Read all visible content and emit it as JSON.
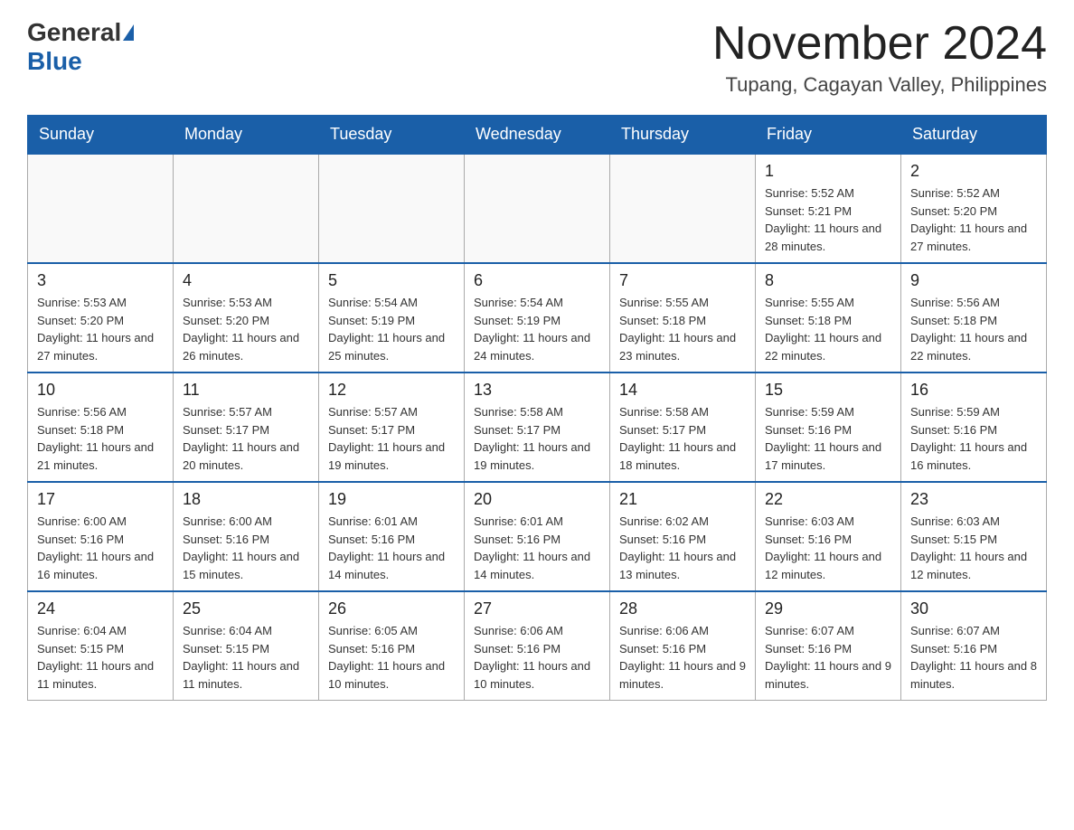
{
  "header": {
    "logo_general": "General",
    "logo_blue": "Blue",
    "month_title": "November 2024",
    "location": "Tupang, Cagayan Valley, Philippines"
  },
  "calendar": {
    "days_of_week": [
      "Sunday",
      "Monday",
      "Tuesday",
      "Wednesday",
      "Thursday",
      "Friday",
      "Saturday"
    ],
    "weeks": [
      [
        {
          "day": "",
          "info": ""
        },
        {
          "day": "",
          "info": ""
        },
        {
          "day": "",
          "info": ""
        },
        {
          "day": "",
          "info": ""
        },
        {
          "day": "",
          "info": ""
        },
        {
          "day": "1",
          "info": "Sunrise: 5:52 AM\nSunset: 5:21 PM\nDaylight: 11 hours and 28 minutes."
        },
        {
          "day": "2",
          "info": "Sunrise: 5:52 AM\nSunset: 5:20 PM\nDaylight: 11 hours and 27 minutes."
        }
      ],
      [
        {
          "day": "3",
          "info": "Sunrise: 5:53 AM\nSunset: 5:20 PM\nDaylight: 11 hours and 27 minutes."
        },
        {
          "day": "4",
          "info": "Sunrise: 5:53 AM\nSunset: 5:20 PM\nDaylight: 11 hours and 26 minutes."
        },
        {
          "day": "5",
          "info": "Sunrise: 5:54 AM\nSunset: 5:19 PM\nDaylight: 11 hours and 25 minutes."
        },
        {
          "day": "6",
          "info": "Sunrise: 5:54 AM\nSunset: 5:19 PM\nDaylight: 11 hours and 24 minutes."
        },
        {
          "day": "7",
          "info": "Sunrise: 5:55 AM\nSunset: 5:18 PM\nDaylight: 11 hours and 23 minutes."
        },
        {
          "day": "8",
          "info": "Sunrise: 5:55 AM\nSunset: 5:18 PM\nDaylight: 11 hours and 22 minutes."
        },
        {
          "day": "9",
          "info": "Sunrise: 5:56 AM\nSunset: 5:18 PM\nDaylight: 11 hours and 22 minutes."
        }
      ],
      [
        {
          "day": "10",
          "info": "Sunrise: 5:56 AM\nSunset: 5:18 PM\nDaylight: 11 hours and 21 minutes."
        },
        {
          "day": "11",
          "info": "Sunrise: 5:57 AM\nSunset: 5:17 PM\nDaylight: 11 hours and 20 minutes."
        },
        {
          "day": "12",
          "info": "Sunrise: 5:57 AM\nSunset: 5:17 PM\nDaylight: 11 hours and 19 minutes."
        },
        {
          "day": "13",
          "info": "Sunrise: 5:58 AM\nSunset: 5:17 PM\nDaylight: 11 hours and 19 minutes."
        },
        {
          "day": "14",
          "info": "Sunrise: 5:58 AM\nSunset: 5:17 PM\nDaylight: 11 hours and 18 minutes."
        },
        {
          "day": "15",
          "info": "Sunrise: 5:59 AM\nSunset: 5:16 PM\nDaylight: 11 hours and 17 minutes."
        },
        {
          "day": "16",
          "info": "Sunrise: 5:59 AM\nSunset: 5:16 PM\nDaylight: 11 hours and 16 minutes."
        }
      ],
      [
        {
          "day": "17",
          "info": "Sunrise: 6:00 AM\nSunset: 5:16 PM\nDaylight: 11 hours and 16 minutes."
        },
        {
          "day": "18",
          "info": "Sunrise: 6:00 AM\nSunset: 5:16 PM\nDaylight: 11 hours and 15 minutes."
        },
        {
          "day": "19",
          "info": "Sunrise: 6:01 AM\nSunset: 5:16 PM\nDaylight: 11 hours and 14 minutes."
        },
        {
          "day": "20",
          "info": "Sunrise: 6:01 AM\nSunset: 5:16 PM\nDaylight: 11 hours and 14 minutes."
        },
        {
          "day": "21",
          "info": "Sunrise: 6:02 AM\nSunset: 5:16 PM\nDaylight: 11 hours and 13 minutes."
        },
        {
          "day": "22",
          "info": "Sunrise: 6:03 AM\nSunset: 5:16 PM\nDaylight: 11 hours and 12 minutes."
        },
        {
          "day": "23",
          "info": "Sunrise: 6:03 AM\nSunset: 5:15 PM\nDaylight: 11 hours and 12 minutes."
        }
      ],
      [
        {
          "day": "24",
          "info": "Sunrise: 6:04 AM\nSunset: 5:15 PM\nDaylight: 11 hours and 11 minutes."
        },
        {
          "day": "25",
          "info": "Sunrise: 6:04 AM\nSunset: 5:15 PM\nDaylight: 11 hours and 11 minutes."
        },
        {
          "day": "26",
          "info": "Sunrise: 6:05 AM\nSunset: 5:16 PM\nDaylight: 11 hours and 10 minutes."
        },
        {
          "day": "27",
          "info": "Sunrise: 6:06 AM\nSunset: 5:16 PM\nDaylight: 11 hours and 10 minutes."
        },
        {
          "day": "28",
          "info": "Sunrise: 6:06 AM\nSunset: 5:16 PM\nDaylight: 11 hours and 9 minutes."
        },
        {
          "day": "29",
          "info": "Sunrise: 6:07 AM\nSunset: 5:16 PM\nDaylight: 11 hours and 9 minutes."
        },
        {
          "day": "30",
          "info": "Sunrise: 6:07 AM\nSunset: 5:16 PM\nDaylight: 11 hours and 8 minutes."
        }
      ]
    ]
  }
}
